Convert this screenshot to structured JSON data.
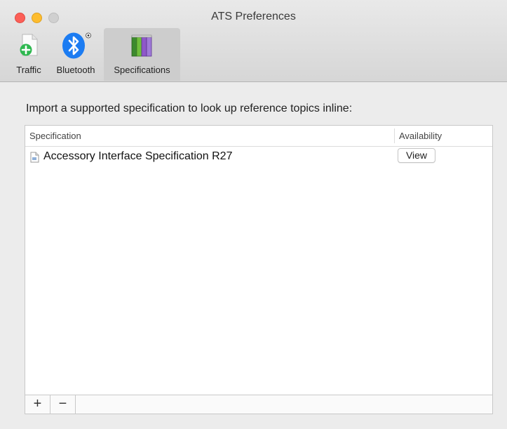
{
  "window": {
    "title": "ATS Preferences"
  },
  "toolbar": {
    "items": [
      {
        "label": "Traffic",
        "icon": "document-add-icon"
      },
      {
        "label": "Bluetooth",
        "icon": "bluetooth-icon"
      },
      {
        "label": "Specifications",
        "icon": "books-icon",
        "selected": true
      }
    ]
  },
  "main": {
    "intro": "Import a supported specification to look up reference topics inline:",
    "table": {
      "columns": [
        "Specification",
        "Availability"
      ],
      "rows": [
        {
          "name": "Accessory Interface Specification R27",
          "action": "View"
        }
      ]
    },
    "footer": {
      "add_label": "+",
      "remove_label": "−"
    }
  },
  "colors": {
    "close": "#fc5f57",
    "minimize": "#fdbc2e",
    "zoom": "#d0d0d0",
    "bluetooth": "#1c7cf2",
    "traffic_add": "#2fb850"
  }
}
